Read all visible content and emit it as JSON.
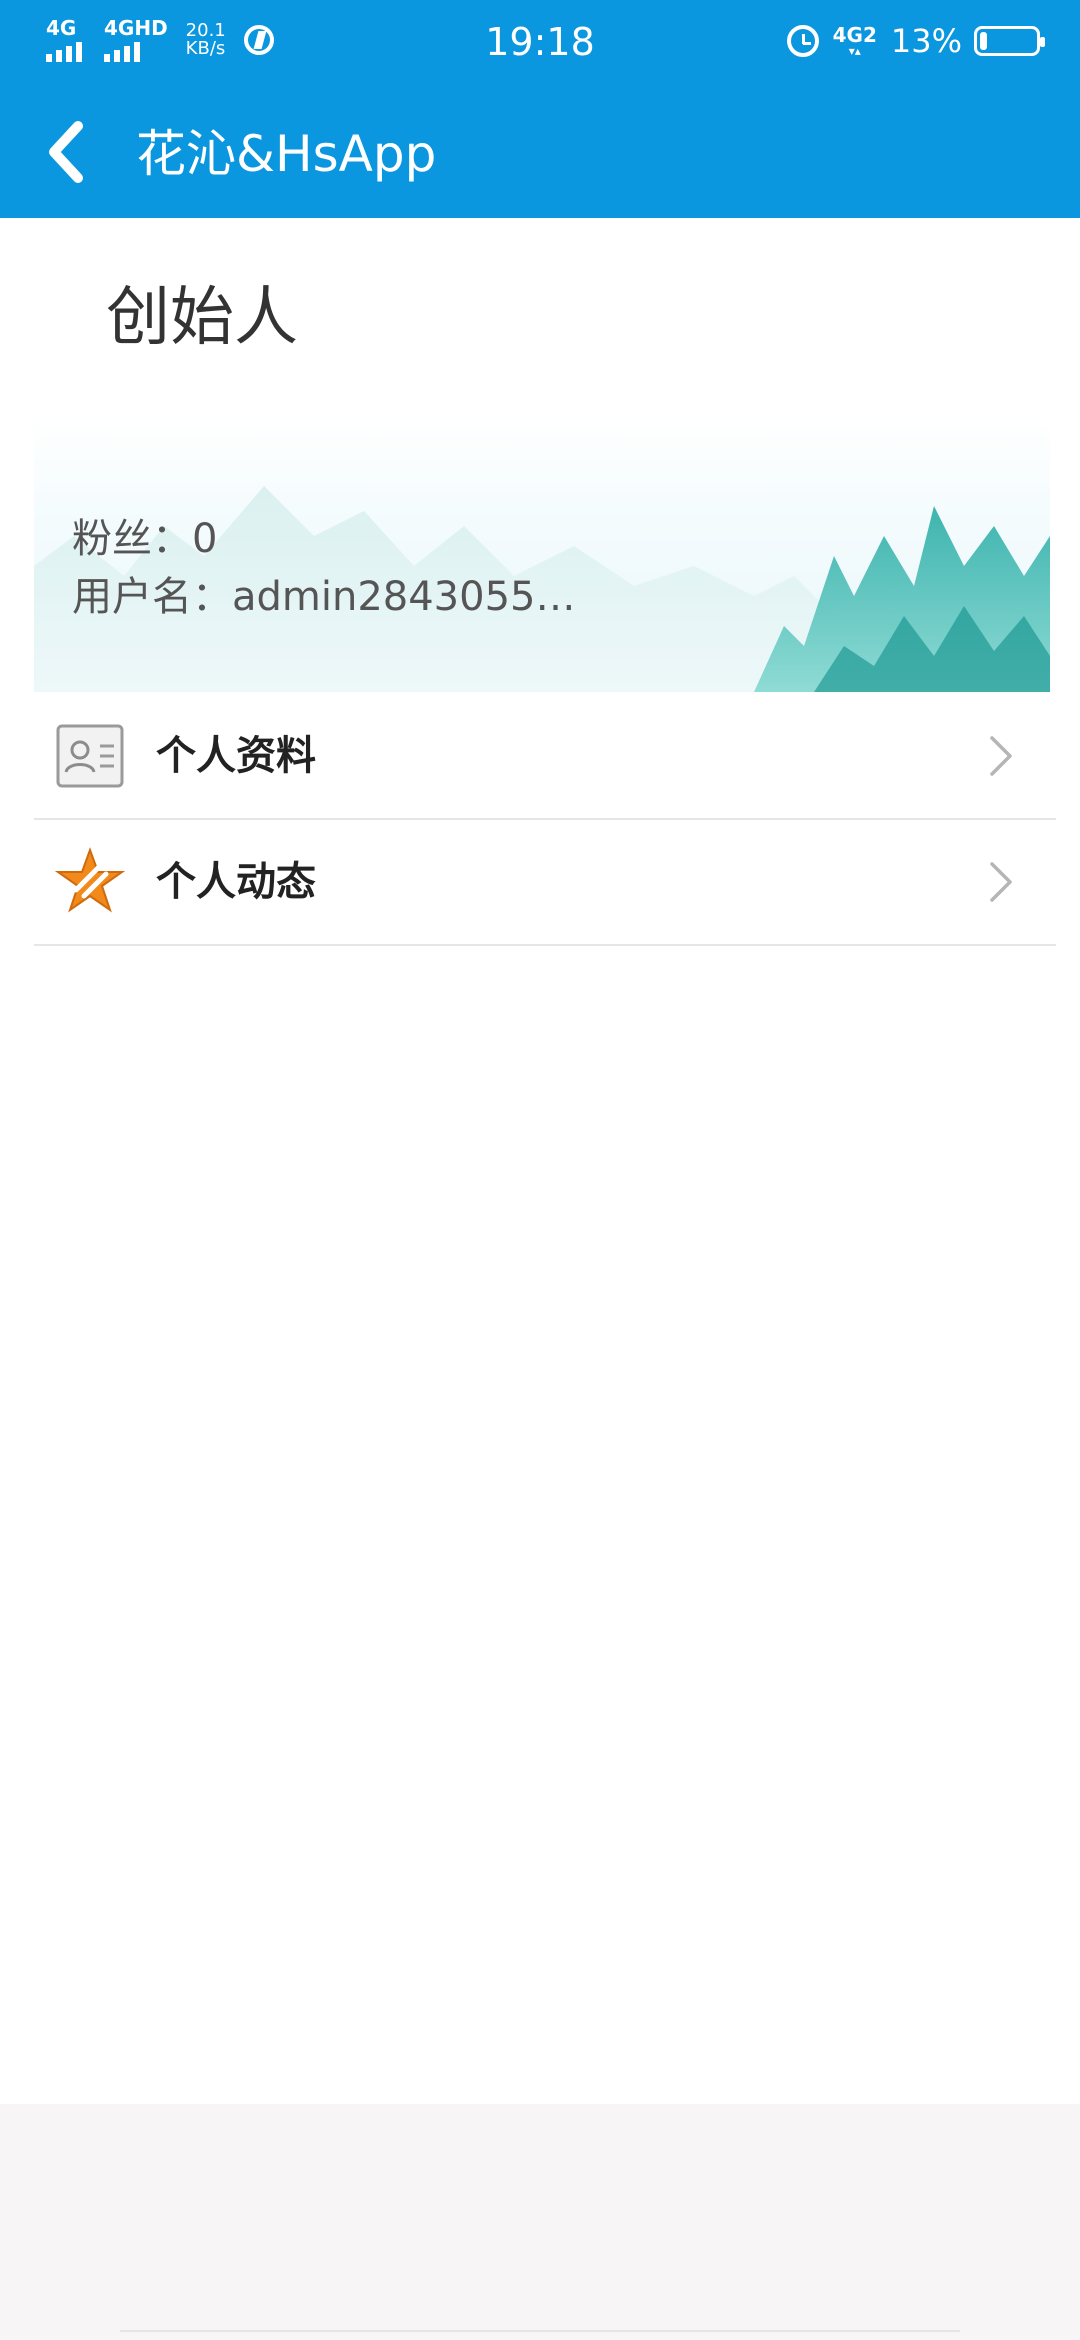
{
  "status_bar": {
    "signal1_label": "4G",
    "signal2_label": "4GHD",
    "speed_value": "20.1",
    "speed_unit": "KB/s",
    "time": "19:18",
    "network_label": "4G2",
    "battery_percent_text": "13%",
    "battery_level": 0.13
  },
  "app_bar": {
    "title": "花沁&HsApp"
  },
  "profile": {
    "title": "创始人",
    "fans_line": "粉丝：0",
    "username_line": "用户名：admin2843055…"
  },
  "menu": {
    "items": [
      {
        "label": "个人资料",
        "icon": "profile-card-icon"
      },
      {
        "label": "个人动态",
        "icon": "star-dynamic-icon"
      }
    ]
  }
}
